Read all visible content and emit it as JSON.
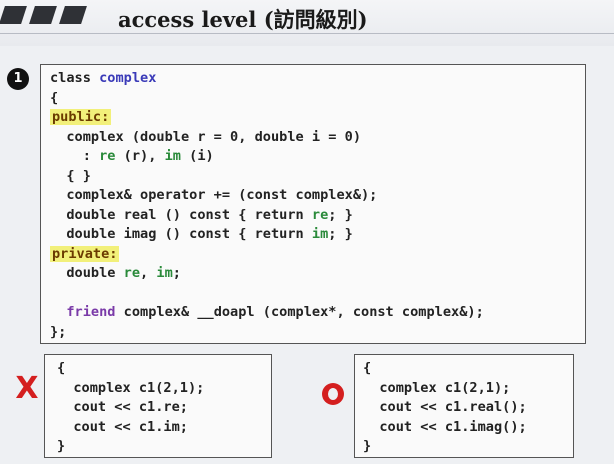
{
  "slide": {
    "title": "access level (訪問級別)",
    "badge": "1"
  },
  "class_code": {
    "lines": [
      {
        "parts": [
          {
            "t": "class ",
            "c": ""
          },
          {
            "t": "complex",
            "c": "kw"
          }
        ]
      },
      {
        "parts": [
          {
            "t": "{",
            "c": ""
          }
        ]
      },
      {
        "parts": [
          {
            "t": "public:",
            "c": "hl"
          }
        ]
      },
      {
        "parts": [
          {
            "t": "  complex (double r = 0, double i = 0)",
            "c": ""
          }
        ]
      },
      {
        "parts": [
          {
            "t": "    : ",
            "c": ""
          },
          {
            "t": "re",
            "c": "mem"
          },
          {
            "t": " (r), ",
            "c": ""
          },
          {
            "t": "im",
            "c": "mem"
          },
          {
            "t": " (i)",
            "c": ""
          }
        ]
      },
      {
        "parts": [
          {
            "t": "  { }",
            "c": ""
          }
        ]
      },
      {
        "parts": [
          {
            "t": "  complex& operator += (const complex&);",
            "c": ""
          }
        ]
      },
      {
        "parts": [
          {
            "t": "  double real () const { return ",
            "c": ""
          },
          {
            "t": "re",
            "c": "mem"
          },
          {
            "t": "; }",
            "c": ""
          }
        ]
      },
      {
        "parts": [
          {
            "t": "  double imag () const { return ",
            "c": ""
          },
          {
            "t": "im",
            "c": "mem"
          },
          {
            "t": "; }",
            "c": ""
          }
        ]
      },
      {
        "parts": [
          {
            "t": "private:",
            "c": "hl"
          }
        ]
      },
      {
        "parts": [
          {
            "t": "  double ",
            "c": ""
          },
          {
            "t": "re",
            "c": "mem"
          },
          {
            "t": ", ",
            "c": ""
          },
          {
            "t": "im",
            "c": "mem"
          },
          {
            "t": ";",
            "c": ""
          }
        ]
      },
      {
        "parts": [
          {
            "t": "",
            "c": ""
          }
        ]
      },
      {
        "parts": [
          {
            "t": "  ",
            "c": ""
          },
          {
            "t": "friend",
            "c": "friend"
          },
          {
            "t": " complex& __doapl (complex*, const complex&);",
            "c": ""
          }
        ]
      },
      {
        "parts": [
          {
            "t": "};",
            "c": ""
          }
        ]
      }
    ]
  },
  "wrong_example": {
    "mark": "X",
    "lines": [
      "{",
      "  complex c1(2,1);",
      "  cout << c1.re;",
      "  cout << c1.im;",
      "}"
    ]
  },
  "right_example": {
    "mark": "O",
    "lines": [
      "{",
      "  complex c1(2,1);",
      "  cout << c1.real();",
      "  cout << c1.imag();",
      "}"
    ]
  }
}
